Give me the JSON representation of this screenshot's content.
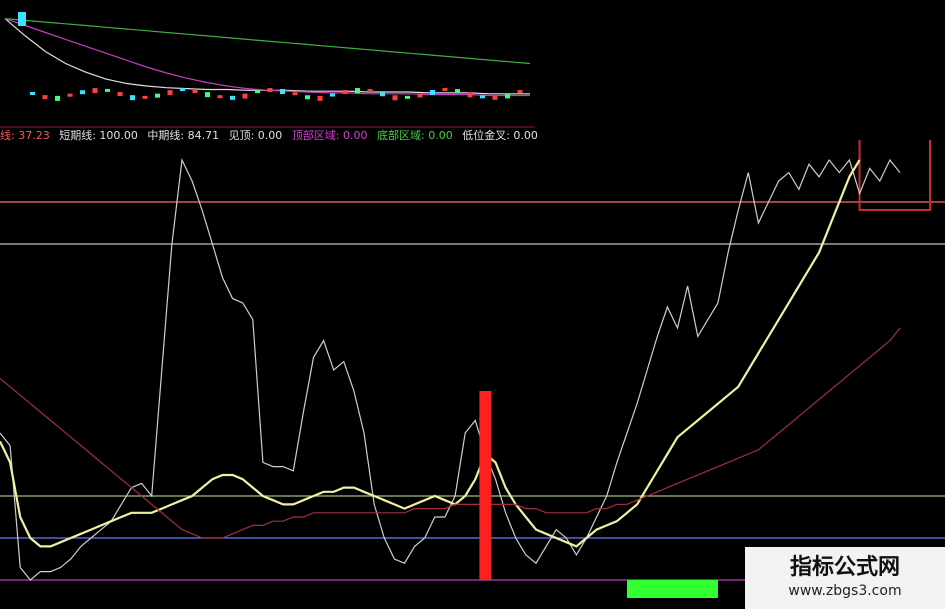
{
  "legend": {
    "items": [
      {
        "text": "线: 37.23",
        "color": "#ff5555"
      },
      {
        "text": "短期线: 100.00",
        "color": "#e0e0e0"
      },
      {
        "text": "中期线: 84.71",
        "color": "#e0e0e0"
      },
      {
        "text": "见顶: 0.00",
        "color": "#e0e0e0"
      },
      {
        "text": "顶部区域: 0.00",
        "color": "#d040d0"
      },
      {
        "text": "底部区域: 0.00",
        "color": "#40d040"
      },
      {
        "text": "低位金叉: 0.00",
        "color": "#e0e0e0"
      }
    ]
  },
  "watermark": {
    "title": "指标公式网",
    "url": "www.zbgs3.com"
  },
  "chart_data": [
    {
      "type": "line",
      "name": "kline-overview",
      "x": [
        0,
        1,
        2,
        3,
        4,
        5,
        6,
        7,
        8,
        9,
        10,
        11,
        12,
        13,
        14,
        15,
        16,
        17,
        18,
        19,
        20,
        21,
        22,
        23,
        24,
        25,
        26
      ],
      "series": [
        {
          "values": [
            100,
            80,
            62,
            48,
            38,
            30,
            25,
            22,
            20,
            19,
            18,
            18,
            17,
            17,
            17,
            16,
            16,
            16,
            15,
            15,
            15,
            14,
            14,
            14,
            13,
            13,
            13
          ],
          "color": "#e0e0e0"
        },
        {
          "values": [
            100,
            92,
            84,
            76,
            68,
            60,
            52,
            44,
            37,
            31,
            26,
            22,
            19,
            17,
            16,
            15,
            14,
            14,
            13,
            13,
            13,
            12,
            12,
            12,
            11,
            11,
            11
          ],
          "color": "#c040c0"
        },
        {
          "values": [
            100,
            98,
            96,
            94,
            92,
            90,
            88,
            86,
            84,
            82,
            80,
            78,
            76,
            74,
            72,
            70,
            68,
            66,
            64,
            62,
            60,
            58,
            56,
            54,
            52,
            50,
            48
          ],
          "color": "#40b040"
        }
      ],
      "ylim": [
        0,
        110
      ]
    },
    {
      "type": "line",
      "name": "main-indicator",
      "x": [
        0,
        1,
        2,
        3,
        4,
        5,
        6,
        7,
        8,
        9,
        10,
        11,
        12,
        13,
        14,
        15,
        16,
        17,
        18,
        19,
        20,
        21,
        22,
        23,
        24,
        25,
        26,
        27,
        28,
        29,
        30,
        31,
        32,
        33,
        34,
        35,
        36,
        37,
        38,
        39,
        40,
        41,
        42,
        43,
        44,
        45,
        46,
        47,
        48,
        49,
        50,
        51,
        52,
        53,
        54,
        55,
        56,
        57,
        58,
        59,
        60,
        61,
        62,
        63,
        64,
        65,
        66,
        67,
        68,
        69,
        70,
        71,
        72,
        73,
        74,
        75,
        76,
        77,
        78,
        79,
        80,
        81,
        82,
        83,
        84,
        85,
        86,
        87,
        88,
        89
      ],
      "series": [
        {
          "name": "短期线",
          "color": "#cfcfcf",
          "values": [
            35,
            32,
            3,
            0,
            2,
            2,
            3,
            5,
            8,
            10,
            12,
            14,
            18,
            22,
            23,
            20,
            50,
            80,
            100,
            95,
            88,
            80,
            72,
            67,
            66,
            62,
            28,
            27,
            27,
            26,
            40,
            53,
            57,
            50,
            52,
            45,
            35,
            18,
            10,
            5,
            4,
            8,
            10,
            15,
            15,
            20,
            35,
            38,
            30,
            24,
            16,
            10,
            6,
            4,
            8,
            12,
            10,
            6,
            10,
            15,
            20,
            28,
            35,
            42,
            50,
            58,
            65,
            60,
            70,
            58,
            62,
            66,
            78,
            88,
            97,
            85,
            90,
            95,
            97,
            93,
            99,
            96,
            100,
            97,
            100,
            92,
            98,
            95,
            100,
            97
          ]
        },
        {
          "name": "中期线",
          "color": "#f0f0a0",
          "values": [
            33,
            28,
            15,
            10,
            8,
            8,
            9,
            10,
            11,
            12,
            13,
            14,
            15,
            16,
            16,
            16,
            17,
            18,
            19,
            20,
            22,
            24,
            25,
            25,
            24,
            22,
            20,
            19,
            18,
            18,
            19,
            20,
            21,
            21,
            22,
            22,
            21,
            20,
            19,
            18,
            17,
            18,
            19,
            20,
            19,
            18,
            20,
            24,
            30,
            28,
            22,
            18,
            15,
            12,
            11,
            10,
            9,
            8,
            10,
            12,
            13,
            14,
            16,
            18,
            22,
            26,
            30,
            34,
            36,
            38,
            40,
            42,
            44,
            46,
            50,
            54,
            58,
            62,
            66,
            70,
            74,
            78,
            84,
            90,
            96,
            100
          ]
        },
        {
          "name": "趋势线",
          "color": "#a03040",
          "values": [
            48,
            46,
            44,
            42,
            40,
            38,
            36,
            34,
            32,
            30,
            28,
            26,
            24,
            22,
            20,
            18,
            16,
            14,
            12,
            11,
            10,
            10,
            10,
            11,
            12,
            13,
            13,
            14,
            14,
            15,
            15,
            16,
            16,
            16,
            16,
            16,
            16,
            16,
            16,
            16,
            16,
            17,
            17,
            17,
            17,
            18,
            18,
            18,
            18,
            18,
            18,
            18,
            17,
            17,
            16,
            16,
            16,
            16,
            16,
            17,
            17,
            18,
            18,
            19,
            20,
            21,
            22,
            23,
            24,
            25,
            26,
            27,
            28,
            29,
            30,
            31,
            33,
            35,
            37,
            39,
            41,
            43,
            45,
            47,
            49,
            51,
            53,
            55,
            57,
            60
          ]
        }
      ],
      "hlines": [
        {
          "value": 90,
          "color": "#ff6b6b"
        },
        {
          "value": 80,
          "color": "#c0c0c0"
        },
        {
          "value": 20,
          "color": "#a0c080"
        },
        {
          "value": 10,
          "color": "#6080ff"
        },
        {
          "value": 0,
          "color": "#c040c0"
        }
      ],
      "bars": [
        {
          "x": 48,
          "bottom": 0,
          "top": 45,
          "color": "#ff2020"
        },
        {
          "x_start": 62,
          "x_end": 71,
          "bottom": -4,
          "top": 0,
          "color": "#30ff30"
        }
      ],
      "ylim": [
        -5,
        100
      ]
    }
  ]
}
